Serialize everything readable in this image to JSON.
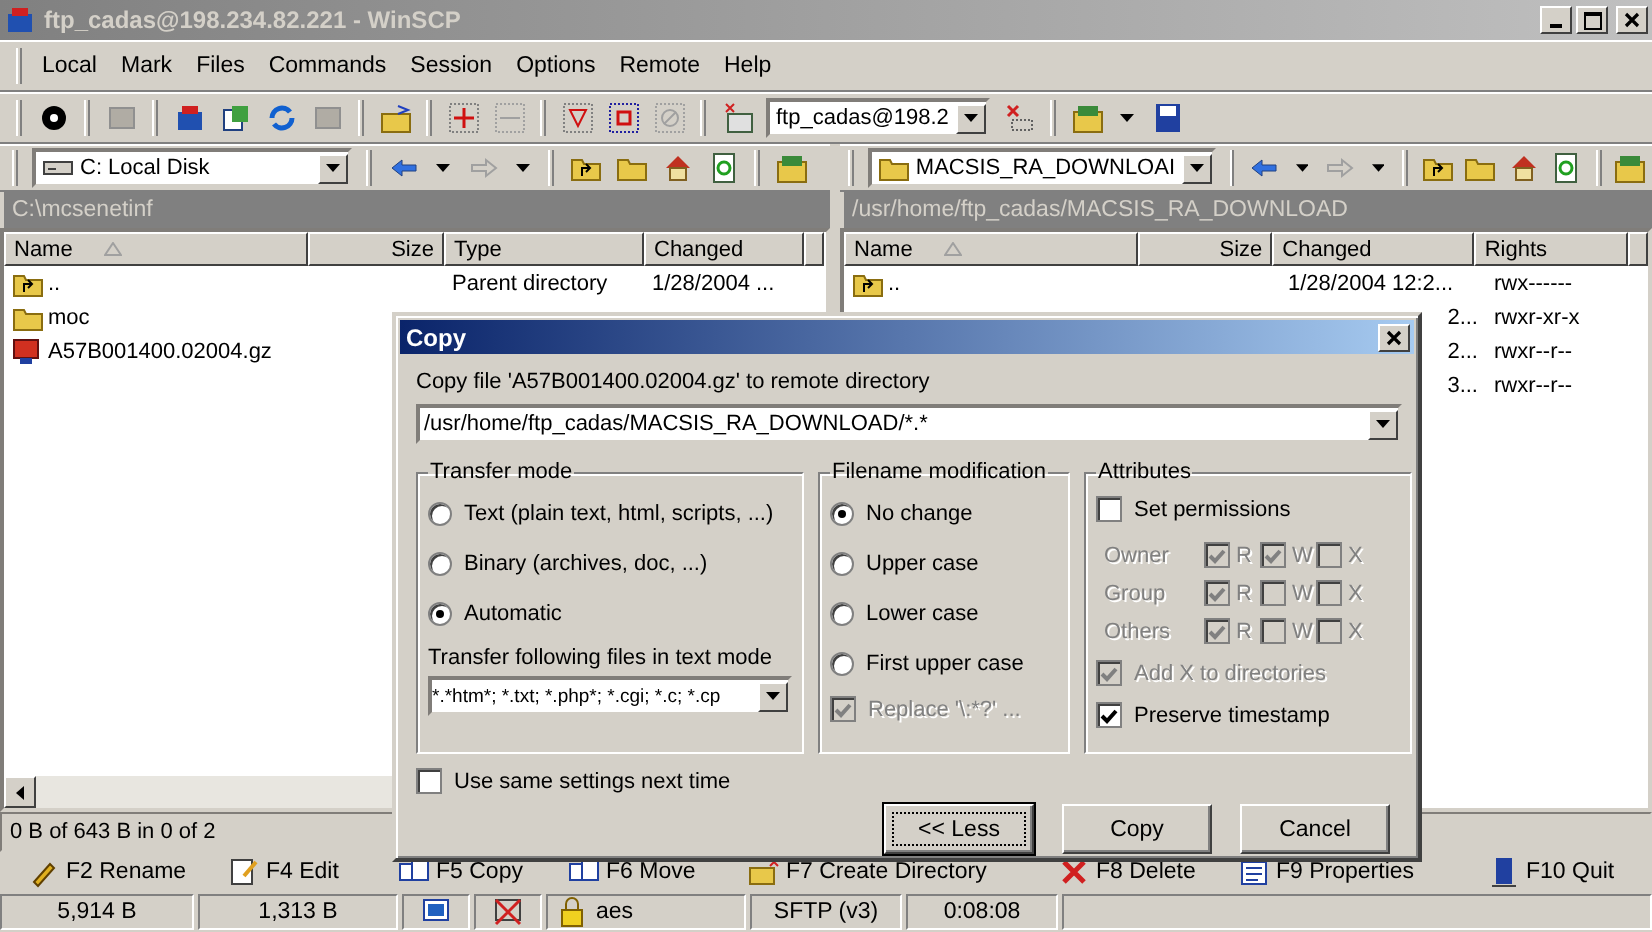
{
  "window": {
    "title": "ftp_cadas@198.234.82.221 - WinSCP"
  },
  "menu": [
    "Local",
    "Mark",
    "Files",
    "Commands",
    "Session",
    "Options",
    "Remote",
    "Help"
  ],
  "session_box": {
    "value": "ftp_cadas@198.2"
  },
  "local_panel": {
    "drive": "C: Local Disk",
    "path": "C:\\mcsenetinf",
    "columns": [
      "Name",
      "Size",
      "Type",
      "Changed"
    ],
    "rows": [
      {
        "kind": "parent",
        "name": "..",
        "type": "Parent directory",
        "changed": "1/28/2004 ..."
      },
      {
        "kind": "folder",
        "name": "moc"
      },
      {
        "kind": "file",
        "name": "A57B001400.02004.gz"
      }
    ],
    "status": "0 B of 643 B in 0 of 2"
  },
  "remote_panel": {
    "folder": "MACSIS_RA_DOWNLOAI",
    "path": "/usr/home/ftp_cadas/MACSIS_RA_DOWNLOAD",
    "columns": [
      "Name",
      "Size",
      "Changed",
      "Rights"
    ],
    "rows": [
      {
        "kind": "parent",
        "name": "..",
        "changed": "1/28/2004 12:2...",
        "rights": "rwx------"
      },
      {
        "changed": "2...",
        "rights": "rwxr-xr-x"
      },
      {
        "changed": "2...",
        "rights": "rwxr--r--"
      },
      {
        "changed": "3...",
        "rights": "rwxr--r--"
      }
    ]
  },
  "dialog": {
    "title": "Copy",
    "prompt": "Copy file 'A57B001400.02004.gz' to remote directory",
    "target": "/usr/home/ftp_cadas/MACSIS_RA_DOWNLOAD/*.*",
    "transfer_mode": {
      "label": "Transfer mode",
      "options": [
        {
          "label": "Text (plain text, html, scripts, ...)",
          "selected": false
        },
        {
          "label": "Binary (archives, doc, ...)",
          "selected": false
        },
        {
          "label": "Automatic",
          "selected": true
        }
      ],
      "text_mode_label": "Transfer following files in text mode",
      "text_mode_mask": "*.*htm*; *.txt; *.php*; *.cgi; *.c; *.cp"
    },
    "filename_modification": {
      "label": "Filename modification",
      "options": [
        {
          "label": "No change",
          "selected": true
        },
        {
          "label": "Upper case",
          "selected": false
        },
        {
          "label": "Lower case",
          "selected": false
        },
        {
          "label": "First upper case",
          "selected": false
        }
      ],
      "replace": {
        "label": "Replace '\\:*?' ...",
        "checked": true,
        "disabled": true
      }
    },
    "attributes": {
      "label": "Attributes",
      "set_permissions": {
        "label": "Set permissions",
        "checked": false
      },
      "disabled": true,
      "groups": [
        {
          "label": "Owner",
          "perms": [
            {
              "label": "R",
              "checked": true
            },
            {
              "label": "W",
              "checked": true
            },
            {
              "label": "X",
              "checked": false
            }
          ]
        },
        {
          "label": "Group",
          "perms": [
            {
              "label": "R",
              "checked": true
            },
            {
              "label": "W",
              "checked": false
            },
            {
              "label": "X",
              "checked": false
            }
          ]
        },
        {
          "label": "Others",
          "perms": [
            {
              "label": "R",
              "checked": true
            },
            {
              "label": "W",
              "checked": false
            },
            {
              "label": "X",
              "checked": false
            }
          ]
        }
      ],
      "add_x": {
        "label": "Add X to directories",
        "checked": true,
        "disabled": true
      },
      "preserve": {
        "label": "Preserve timestamp",
        "checked": true,
        "disabled": false
      }
    },
    "same_settings": {
      "label": "Use same settings next time",
      "checked": false
    },
    "buttons": [
      "<< Less",
      "Copy",
      "Cancel"
    ]
  },
  "function_keys": [
    "F2 Rename",
    "F4 Edit",
    "F5 Copy",
    "F6 Move",
    "F7 Create Directory",
    "F8 Delete",
    "F9 Properties",
    "F10 Quit"
  ],
  "status_bar": {
    "received": "5,914 B",
    "sent": "1,313 B",
    "cipher": "aes",
    "protocol": "SFTP (v3)",
    "duration": "0:08:08"
  }
}
